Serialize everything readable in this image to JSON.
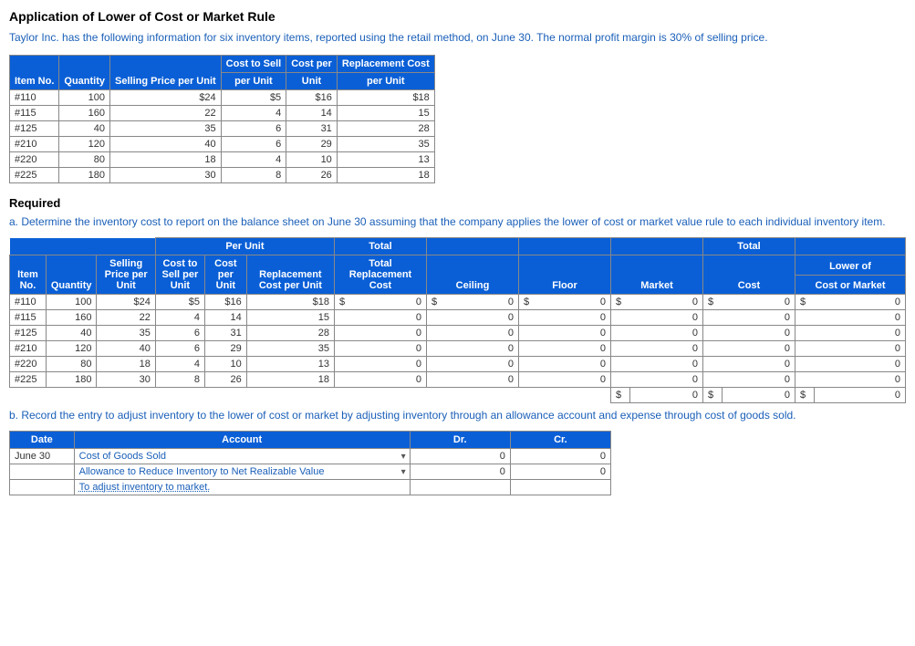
{
  "title": "Application of Lower of Cost or Market Rule",
  "intro": "Taylor Inc. has the following information for six inventory items, reported using the retail method, on June 30. The normal profit margin is 30% of selling price.",
  "table1": {
    "headers": {
      "itemno": "Item No.",
      "quantity": "Quantity",
      "selling": "Selling Price per Unit",
      "costsell_group": "Cost to Sell",
      "costsell_per": "per Unit",
      "costper_group": "Cost per",
      "costper_unit": "Unit",
      "repl_group": "Replacement Cost",
      "repl_per": "per Unit"
    },
    "rows": [
      {
        "no": "#110",
        "qty": "100",
        "sp": "$24",
        "cts": "$5",
        "cpu": "$16",
        "rc": "$18"
      },
      {
        "no": "#115",
        "qty": "160",
        "sp": "22",
        "cts": "4",
        "cpu": "14",
        "rc": "15"
      },
      {
        "no": "#125",
        "qty": "40",
        "sp": "35",
        "cts": "6",
        "cpu": "31",
        "rc": "28"
      },
      {
        "no": "#210",
        "qty": "120",
        "sp": "40",
        "cts": "6",
        "cpu": "29",
        "rc": "35"
      },
      {
        "no": "#220",
        "qty": "80",
        "sp": "18",
        "cts": "4",
        "cpu": "10",
        "rc": "13"
      },
      {
        "no": "#225",
        "qty": "180",
        "sp": "30",
        "cts": "8",
        "cpu": "26",
        "rc": "18"
      }
    ]
  },
  "required_label": "Required",
  "prompt_a": "a. Determine the inventory cost to report on the balance sheet on June 30 assuming that the company applies the lower of cost or market value rule to each individual inventory item.",
  "table2": {
    "headers": {
      "perunit_group": "Per Unit",
      "total_group": "Total",
      "itemno": "Item No.",
      "quantity": "Quantity",
      "selling": "Selling Price per Unit",
      "cts": "Cost to Sell per Unit",
      "cpu": "Cost per Unit",
      "rc": "Replacement Cost per Unit",
      "trc": "Total Replacement Cost",
      "ceiling": "Ceiling",
      "floor": "Floor",
      "market": "Market",
      "total2": "Total",
      "cost": "Cost",
      "lom": "Lower of",
      "cost_or_market": "Cost or Market"
    },
    "rows": [
      {
        "no": "#110",
        "qty": "100",
        "sp": "$24",
        "cts": "$5",
        "cpu": "$16",
        "rc": "$18",
        "d": "$",
        "trc": "0",
        "d2": "$",
        "ceil": "0",
        "d3": "$",
        "floor": "0",
        "d4": "$",
        "market": "0",
        "d5": "$",
        "cost": "0",
        "d6": "$",
        "lom": "0"
      },
      {
        "no": "#115",
        "qty": "160",
        "sp": "22",
        "cts": "4",
        "cpu": "14",
        "rc": "15",
        "d": "",
        "trc": "0",
        "d2": "",
        "ceil": "0",
        "d3": "",
        "floor": "0",
        "d4": "",
        "market": "0",
        "d5": "",
        "cost": "0",
        "d6": "",
        "lom": "0"
      },
      {
        "no": "#125",
        "qty": "40",
        "sp": "35",
        "cts": "6",
        "cpu": "31",
        "rc": "28",
        "d": "",
        "trc": "0",
        "d2": "",
        "ceil": "0",
        "d3": "",
        "floor": "0",
        "d4": "",
        "market": "0",
        "d5": "",
        "cost": "0",
        "d6": "",
        "lom": "0"
      },
      {
        "no": "#210",
        "qty": "120",
        "sp": "40",
        "cts": "6",
        "cpu": "29",
        "rc": "35",
        "d": "",
        "trc": "0",
        "d2": "",
        "ceil": "0",
        "d3": "",
        "floor": "0",
        "d4": "",
        "market": "0",
        "d5": "",
        "cost": "0",
        "d6": "",
        "lom": "0"
      },
      {
        "no": "#220",
        "qty": "80",
        "sp": "18",
        "cts": "4",
        "cpu": "10",
        "rc": "13",
        "d": "",
        "trc": "0",
        "d2": "",
        "ceil": "0",
        "d3": "",
        "floor": "0",
        "d4": "",
        "market": "0",
        "d5": "",
        "cost": "0",
        "d6": "",
        "lom": "0"
      },
      {
        "no": "#225",
        "qty": "180",
        "sp": "30",
        "cts": "8",
        "cpu": "26",
        "rc": "18",
        "d": "",
        "trc": "0",
        "d2": "",
        "ceil": "0",
        "d3": "",
        "floor": "0",
        "d4": "",
        "market": "0",
        "d5": "",
        "cost": "0",
        "d6": "",
        "lom": "0"
      }
    ],
    "totals": {
      "d4": "$",
      "market": "0",
      "d5": "$",
      "cost": "0",
      "d6": "$",
      "lom": "0"
    }
  },
  "prompt_b": "b. Record the entry to adjust inventory to the lower of cost or market by adjusting inventory through an allowance account and expense through cost of goods sold.",
  "table3": {
    "headers": {
      "date": "Date",
      "account": "Account",
      "dr": "Dr.",
      "cr": "Cr."
    },
    "rows": [
      {
        "date": "June 30",
        "account": "Cost of Goods Sold",
        "dr": "0",
        "cr": "0"
      },
      {
        "date": "",
        "account": "Allowance to Reduce Inventory to Net Realizable Value",
        "dr": "0",
        "cr": "0"
      }
    ],
    "memo": "To adjust inventory to market."
  }
}
